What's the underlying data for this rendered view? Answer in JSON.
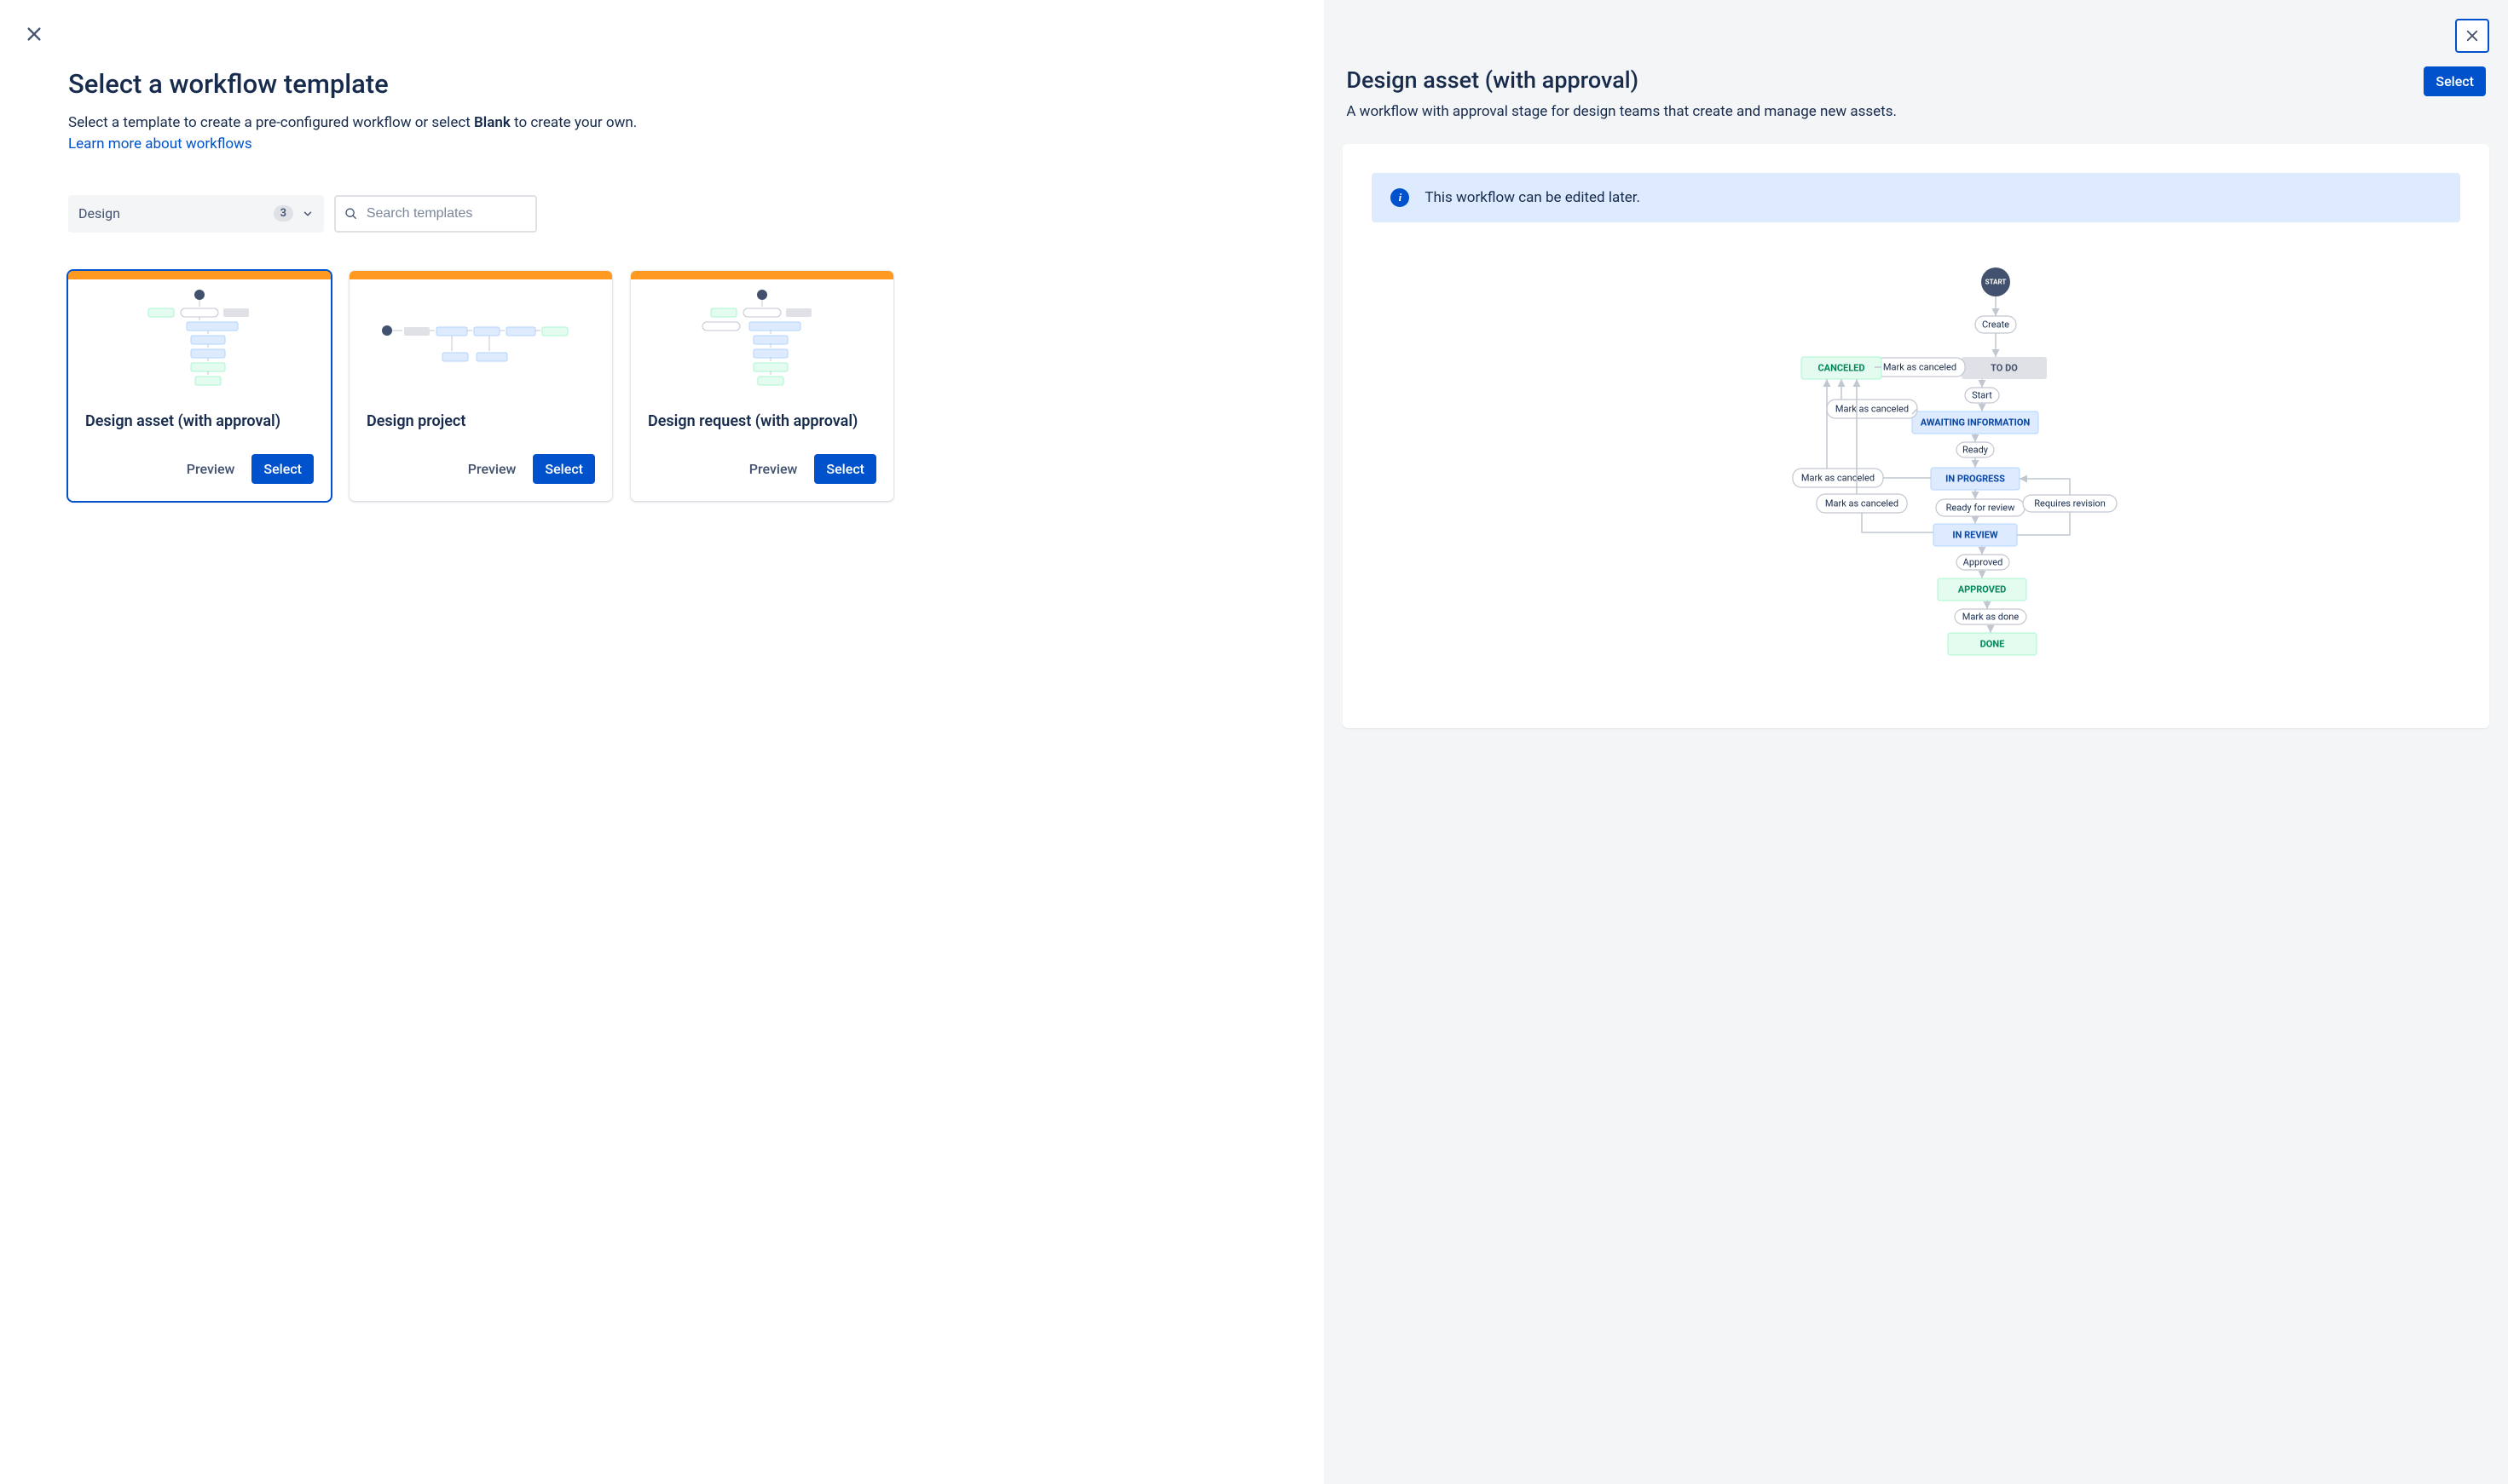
{
  "left": {
    "title": "Select a workflow template",
    "desc_prefix": "Select a template to create a pre-configured workflow or select ",
    "desc_bold": "Blank",
    "desc_suffix": " to create your own.",
    "learn_link": "Learn more about workflows",
    "category": {
      "label": "Design",
      "count": "3"
    },
    "search_placeholder": "Search templates",
    "cards": [
      {
        "title": "Design asset (with approval)",
        "preview": "Preview",
        "select": "Select",
        "selected": true
      },
      {
        "title": "Design project",
        "preview": "Preview",
        "select": "Select",
        "selected": false
      },
      {
        "title": "Design request (with approval)",
        "preview": "Preview",
        "select": "Select",
        "selected": false
      }
    ]
  },
  "right": {
    "title": "Design asset (with approval)",
    "select": "Select",
    "desc": "A workflow with approval stage for design teams that create and manage new assets.",
    "info": "This workflow can be edited later.",
    "workflow": {
      "start": "START",
      "statuses": {
        "canceled": "CANCELED",
        "todo": "TO DO",
        "awaiting": "AWAITING INFORMATION",
        "in_progress": "IN PROGRESS",
        "in_review": "IN REVIEW",
        "approved": "APPROVED",
        "done": "DONE"
      },
      "transitions": {
        "create": "Create",
        "mark_as_canceled": "Mark as canceled",
        "start": "Start",
        "ready": "Ready",
        "ready_for_review": "Ready for review",
        "requires_revision": "Requires revision",
        "approved": "Approved",
        "mark_as_done": "Mark as done"
      }
    }
  }
}
